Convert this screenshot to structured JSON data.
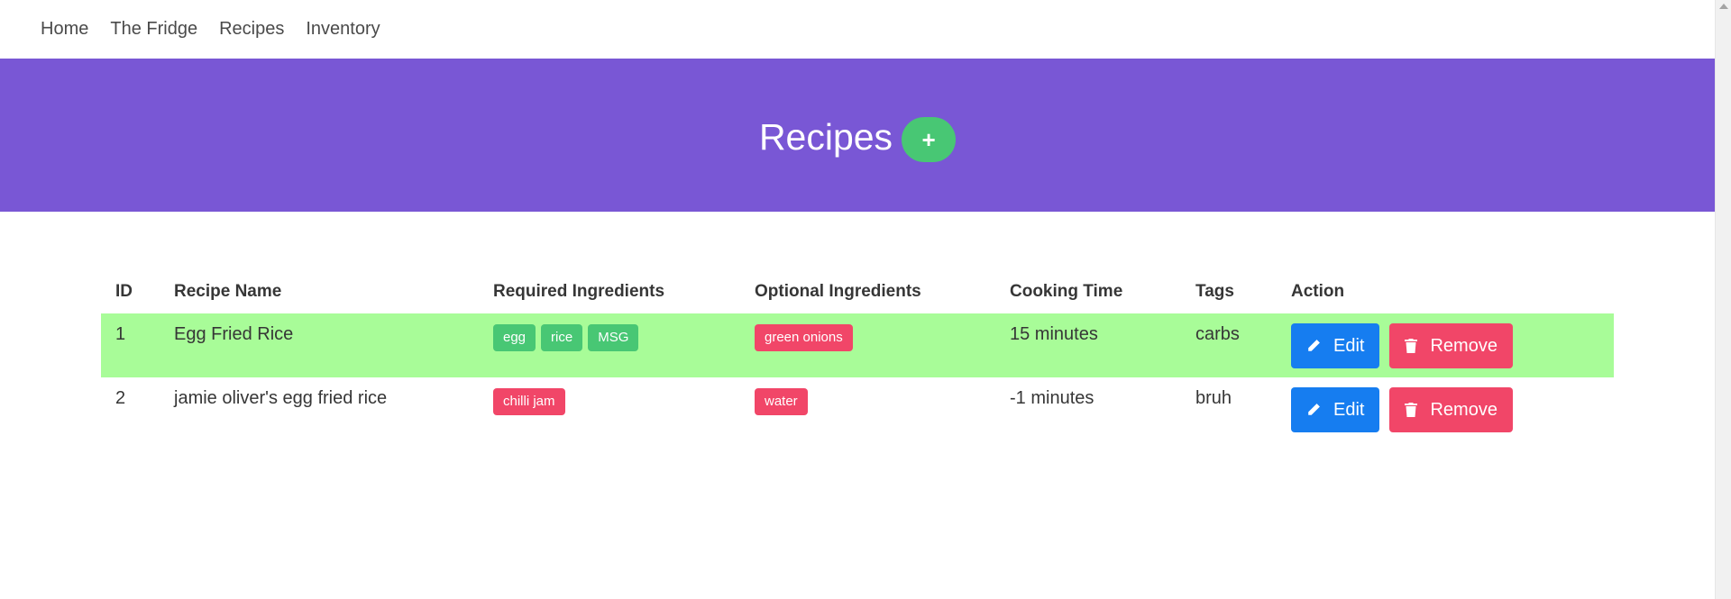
{
  "nav": {
    "items": [
      {
        "label": "Home"
      },
      {
        "label": "The Fridge"
      },
      {
        "label": "Recipes"
      },
      {
        "label": "Inventory"
      }
    ]
  },
  "hero": {
    "title": "Recipes",
    "add_label": "+"
  },
  "table": {
    "headers": {
      "id": "ID",
      "name": "Recipe Name",
      "required": "Required Ingredients",
      "optional": "Optional Ingredients",
      "time": "Cooking Time",
      "tags": "Tags",
      "action": "Action"
    },
    "rows": [
      {
        "id": "1",
        "name": "Egg Fried Rice",
        "required": [
          "egg",
          "rice",
          "MSG"
        ],
        "optional": [
          "green onions"
        ],
        "time": "15 minutes",
        "tags": "carbs",
        "edit_label": "Edit",
        "remove_label": "Remove",
        "selected": true
      },
      {
        "id": "2",
        "name": "jamie oliver's egg fried rice",
        "required": [
          "chilli jam"
        ],
        "optional": [
          "water"
        ],
        "time": "-1 minutes",
        "tags": "bruh",
        "edit_label": "Edit",
        "remove_label": "Remove",
        "selected": false
      }
    ]
  },
  "colors": {
    "hero_bg": "#7957d5",
    "selected_row": "#a8fc98",
    "tag_required": "#48c774",
    "tag_optional": "#f14668",
    "edit": "#167df0",
    "remove": "#f14668",
    "add": "#48c774"
  },
  "icons": {
    "edit": "pencil-icon",
    "remove": "trash-icon"
  }
}
